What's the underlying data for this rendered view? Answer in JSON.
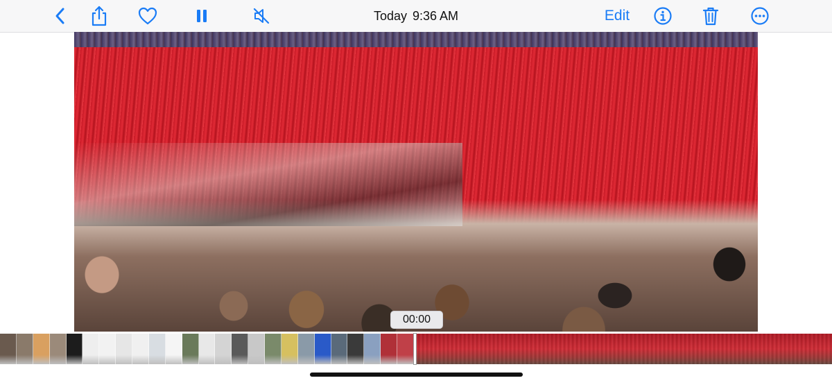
{
  "header": {
    "date": "Today",
    "time": "9:36 AM",
    "edit_label": "Edit"
  },
  "toolbar_icons": [
    "back-chevron-icon",
    "share-icon",
    "heart-icon",
    "pause-icon",
    "mute-icon",
    "info-icon",
    "trash-icon",
    "more-icon"
  ],
  "player": {
    "timecode": "00:00"
  },
  "colors": {
    "accent": "#1a7cf6",
    "bar_background": "#f7f7f8"
  },
  "filmstrip": {
    "thumbnails": [
      "#6a5a4e",
      "#8a7a6a",
      "#d9a060",
      "#9b8a7a",
      "#1c1c1c",
      "#eeeeee",
      "#f2f2f2",
      "#e6e6e6",
      "#f0f0f0",
      "#d8dde2",
      "#f5f5f5",
      "#6a7a5a",
      "#e8e8e8",
      "#d4d4d4",
      "#5a5a5a",
      "#c8c8c8",
      "#7a8a6a",
      "#d6c060",
      "#8a9aa8",
      "#2a5ac8",
      "#5a6a7a",
      "#3a3a3a",
      "#8aa0c0",
      "#b03038",
      "#c04048"
    ],
    "current_clip_color": "#c41f2a"
  }
}
